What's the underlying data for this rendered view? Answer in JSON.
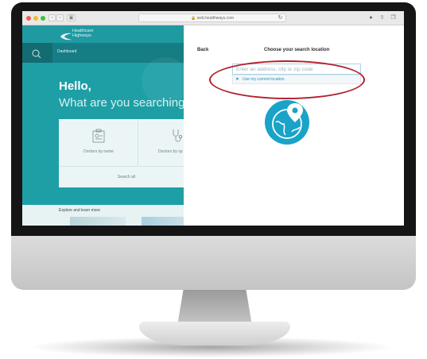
{
  "browser": {
    "url": "web.healthways.com",
    "icons": [
      "sidebar-icon",
      "reload-icon",
      "info-icon",
      "share-icon",
      "tabs-icon"
    ]
  },
  "left_page": {
    "brand": "Healthcare Highways",
    "nav_label": "Dashboard",
    "hello": "Hello,",
    "prompt": "What are you searching",
    "cards": {
      "doctors_by_name": "Doctors by name",
      "doctors_by_specialty": "Doctors by sp",
      "search_all": "Search all"
    },
    "explore": "Explore and learn more"
  },
  "location_panel": {
    "back_label": "Back",
    "title": "Choose your search location",
    "input_placeholder": "Enter an address, city or zip code",
    "current_location_label": "Use my current location"
  },
  "colors": {
    "teal": "#1e9fa6",
    "dark_teal": "#167d84",
    "globe": "#1aa3c8",
    "highlight": "#b3202e",
    "link": "#2e8fc4"
  }
}
